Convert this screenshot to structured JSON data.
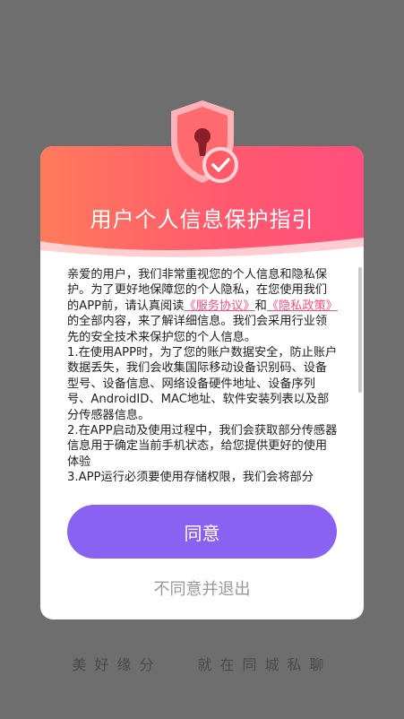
{
  "dialog": {
    "title": "用户个人信息保护指引",
    "content": {
      "intro_before": "亲爱的用户，我们非常重视您的个人信息和隐私保护。为了更好地保障您的个人隐私，在您使用我们的APP前，请认真阅读",
      "service_agreement_link": "《服务协议》",
      "and": "和",
      "privacy_policy_link": "《隐私政策》",
      "intro_after": "的全部内容，来了解详细信息。我们会采用行业领先的安全技术来保护您的个人信息。",
      "point1": "1.在使用APP时，为了您的账户数据安全，防止账户数据丢失，我们会收集国际移动设备识别码、设备型号、设备信息、网络设备硬件地址、设备序列号、AndroidID、MAC地址、软件安装列表以及部分传感器信息。",
      "point2": "2.在APP启动及使用过程中，我们会获取部分传感器信息用于确定当前手机状态，给您提供更好的使用体验",
      "point3": "3.APP运行必须要使用存储权限，我们会将部分"
    },
    "agree_label": "同意",
    "disagree_label": "不同意并退出"
  },
  "background": {
    "slogan_left": "美好缘分",
    "slogan_right": "就在同城私聊"
  },
  "colors": {
    "header_gradient_start": "#ff7a5a",
    "header_gradient_end": "#ff4f7d",
    "agree_button": "#8a62f2",
    "link": "#ff4f7d"
  },
  "icons": {
    "header_badge": "shield-lock-check-icon"
  }
}
